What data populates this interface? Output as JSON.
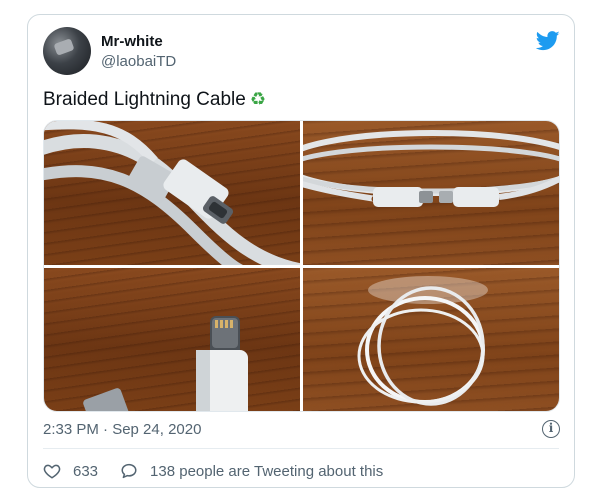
{
  "user": {
    "display_name": "Mr-white",
    "handle": "@laobaiTD"
  },
  "tweet": {
    "text": "Braided Lightning Cable",
    "emoji_icon": "recycle-icon",
    "timestamp": "2:33 PM · Sep 24, 2020"
  },
  "media": {
    "photo_count": 4
  },
  "actions": {
    "like_count": "633",
    "tweeting_label": "138 people are Tweeting about this"
  },
  "colors": {
    "twitter_blue": "#1d9bf0",
    "recycle_green": "#3aa545",
    "muted_text": "#536471"
  }
}
